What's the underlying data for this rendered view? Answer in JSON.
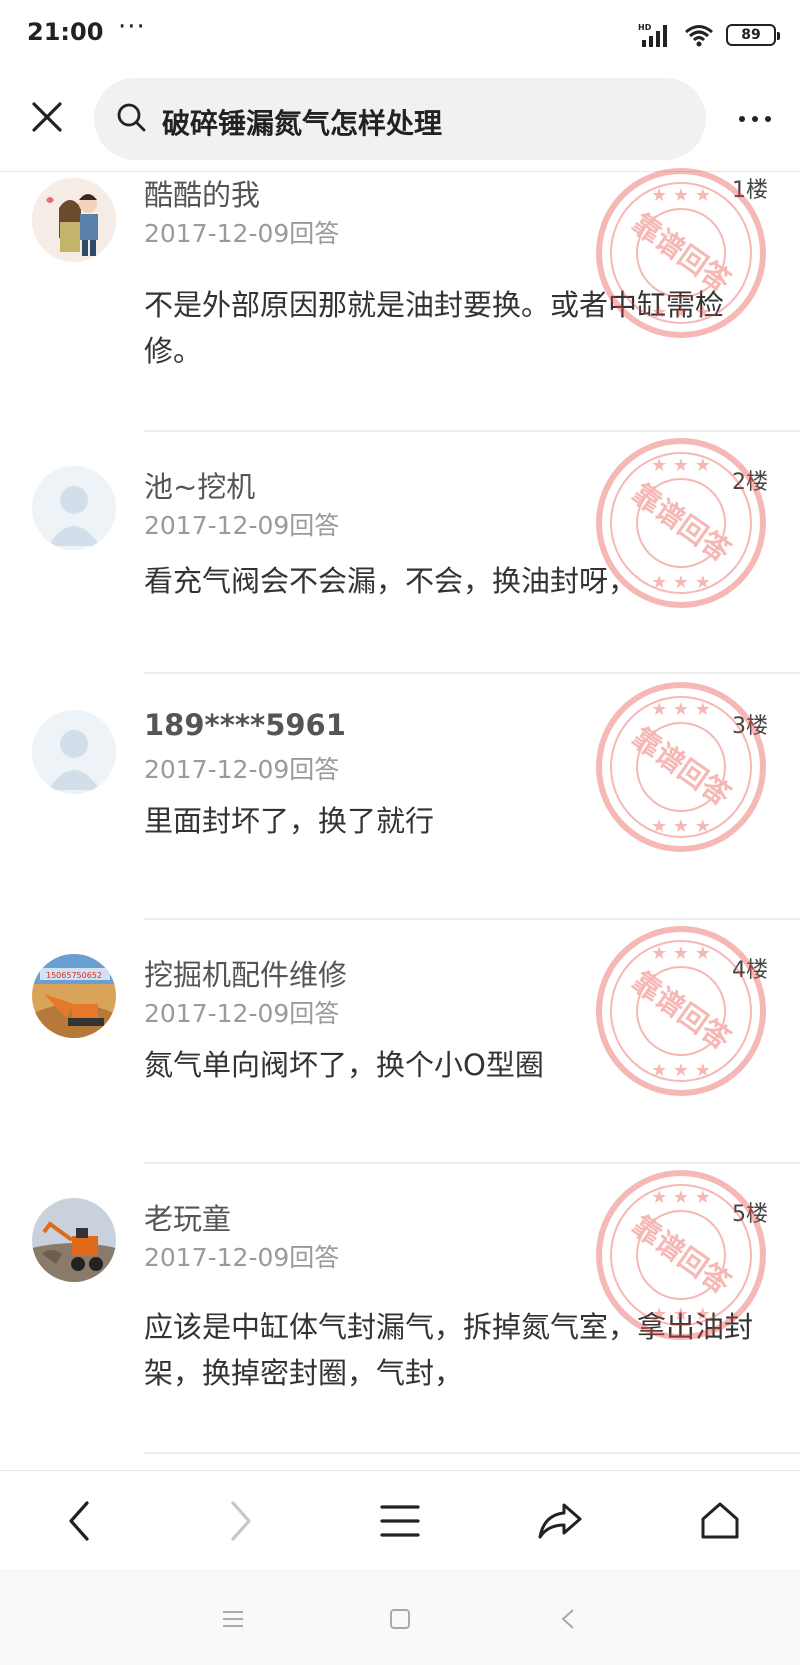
{
  "status_bar": {
    "time": "21:00",
    "dots": "···",
    "battery": "89"
  },
  "search": {
    "query": "破碎锤漏氮气怎样处理"
  },
  "stamp_text": "靠谱回答",
  "answers": [
    {
      "user": "酷酷的我",
      "date": "2017-12-09回答",
      "floor": "1楼",
      "content": "不是外部原因那就是油封要换。或者中缸需检修。"
    },
    {
      "user": "池~挖机",
      "date": "2017-12-09回答",
      "floor": "2楼",
      "content": "看充气阀会不会漏，不会，换油封呀，"
    },
    {
      "user": "189****5961",
      "date": "2017-12-09回答",
      "floor": "3楼",
      "content": "里面封坏了，换了就行"
    },
    {
      "user": "挖掘机配件维修",
      "date": "2017-12-09回答",
      "floor": "4楼",
      "content": "氮气单向阀坏了，换个小O型圈",
      "avatar_text": "15065750652"
    },
    {
      "user": "老玩童",
      "date": "2017-12-09回答",
      "floor": "5楼",
      "content": "应该是中缸体气封漏气，拆掉氮气室，拿出油封架，换掉密封圈，气封，"
    }
  ],
  "colors": {
    "stamp": "#e8463d",
    "avatar_placeholder": "#d6e3ee"
  }
}
